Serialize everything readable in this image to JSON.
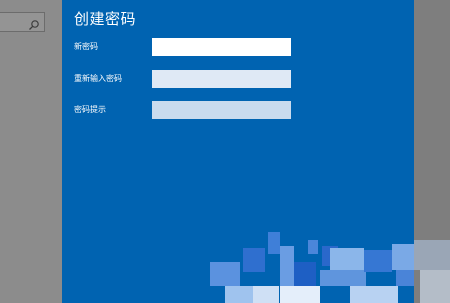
{
  "dialog": {
    "title": "创建密码",
    "fields": [
      {
        "label": "新密码",
        "value": "",
        "placeholder": ""
      },
      {
        "label": "重新输入密码",
        "value": "",
        "placeholder": ""
      },
      {
        "label": "密码提示",
        "value": "",
        "placeholder": ""
      }
    ]
  },
  "icons": {
    "search": "search-icon"
  },
  "colors": {
    "dialog_background": "#0063b1",
    "overlay_gray": "#8a8a8a"
  }
}
